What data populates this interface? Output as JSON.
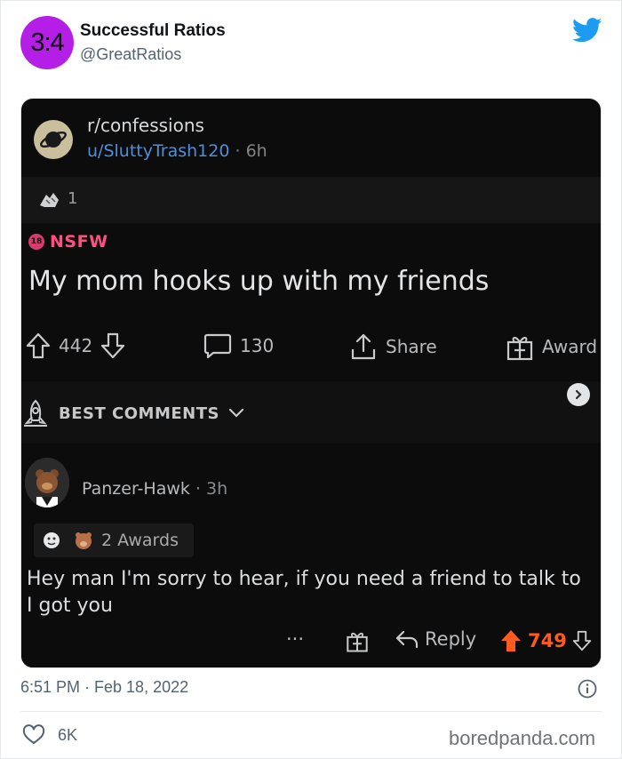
{
  "tweet": {
    "avatar_text": "3:4",
    "author_name": "Successful Ratios",
    "author_handle": "@GreatRatios",
    "timestamp": "6:51 PM · Feb 18, 2022",
    "likes": "6K",
    "watermark": "boredpanda.com"
  },
  "post": {
    "subreddit": "r/confessions",
    "user": "u/SluttyTrash120",
    "meta_separator": "·",
    "age": "6h",
    "award_count": "1",
    "nsfw_badge": "18",
    "nsfw_label": "NSFW",
    "title": "My mom hooks up with my friends",
    "upvotes": "442",
    "comments": "130",
    "share_label": "Share",
    "award_label": "Award",
    "sort_label": "BEST COMMENTS"
  },
  "comment": {
    "user": "Panzer-Hawk",
    "separator": "·",
    "age": "3h",
    "awards_label": "2 Awards",
    "text_line1": "Hey man I'm sorry to hear, if you need a friend to talk to",
    "text_line2": "I got you",
    "more": "···",
    "reply_label": "Reply",
    "score": "749"
  },
  "colors": {
    "avatar_bg": "#b51ee6",
    "twitter_blue": "#1d9bf0",
    "reddit_bg": "#0c0c0d",
    "nsfw_pink": "#ff4f7f",
    "upvote_orange": "#ff5a1f",
    "username_blue": "#4f8fd8"
  }
}
